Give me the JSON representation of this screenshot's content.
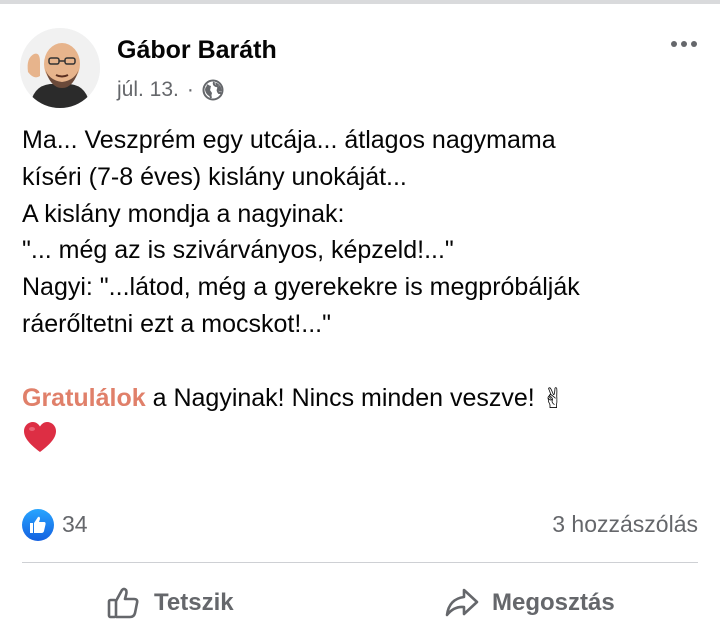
{
  "post": {
    "author": "Gábor Baráth",
    "date": "júl. 13.",
    "separator": "·",
    "audience_icon": "globe-icon",
    "body_lines": [
      "Ma... Veszprém egy utcája... átlagos nagymama",
      "kíséri (7-8 éves) kislány unokáját...",
      "A kislány mondja a nagyinak:",
      "\"... még az is szivárványos, képzeld!...\"",
      "Nagyi: \"...látod, még a gyerekekre is megpróbálják",
      "ráerőltetni ezt a mocskot!...\""
    ],
    "congrats_highlight": "Gratulálok",
    "congrats_rest": " a Nagyinak! Nincs minden veszve! ",
    "congrats_emoji": "✌",
    "heart_emoji": "heart-icon"
  },
  "stats": {
    "like_count": "34",
    "comment_count": "3 hozzászólás"
  },
  "actions": {
    "like_label": "Tetszik",
    "share_label": "Megosztás"
  },
  "colors": {
    "highlight": "#e0806a",
    "secondary_text": "#65676b",
    "like_blue": "#1877f2"
  }
}
